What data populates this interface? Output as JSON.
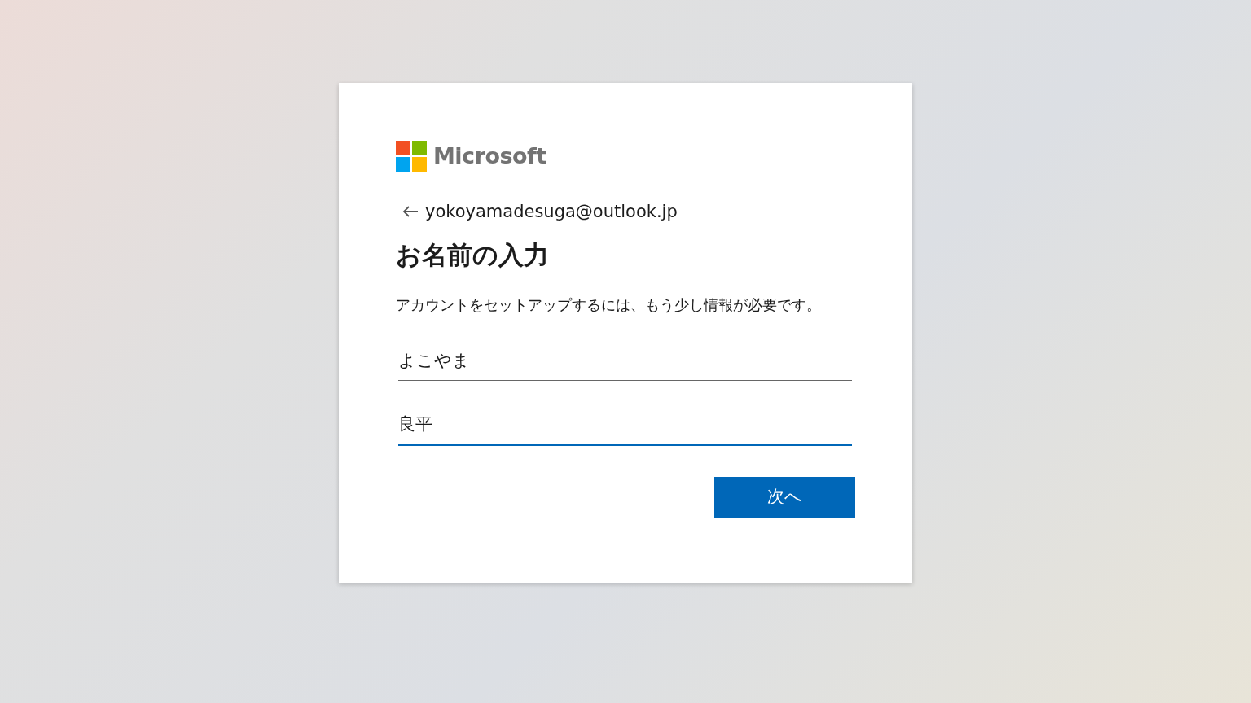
{
  "logo": {
    "text": "Microsoft"
  },
  "identity": {
    "email": "yokoyamadesuga@outlook.jp"
  },
  "title": "お名前の入力",
  "description": "アカウントをセットアップするには、もう少し情報が必要です。",
  "fields": [
    {
      "value": "よこやま",
      "focused": false
    },
    {
      "value": "良平",
      "focused": true
    }
  ],
  "buttons": [
    {
      "label": "次へ",
      "kind": "primary"
    }
  ]
}
